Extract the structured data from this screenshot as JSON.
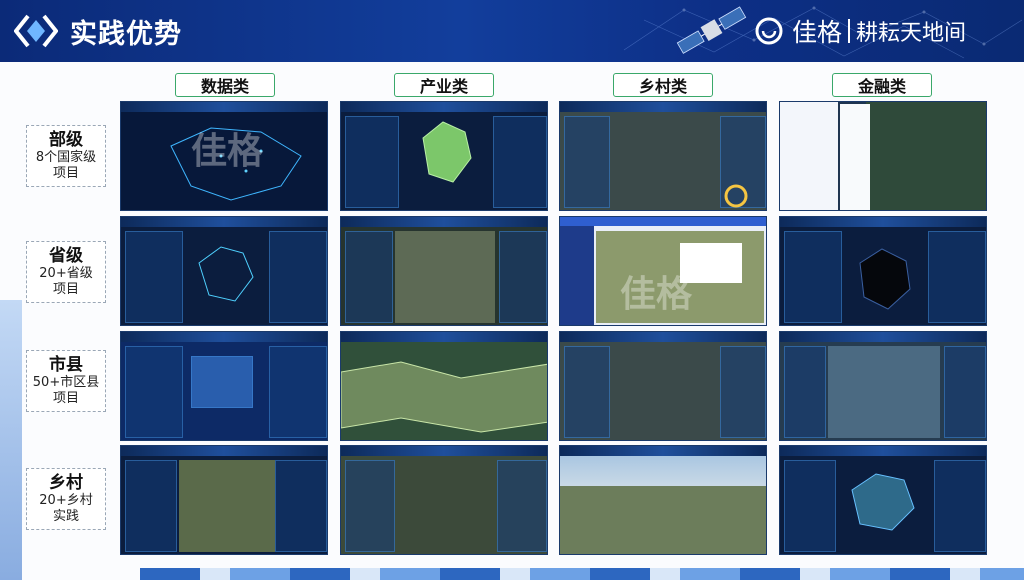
{
  "header": {
    "title": "实践优势",
    "brand": "佳格",
    "slogan": "耕耘天地间"
  },
  "columns": [
    {
      "label": "数据类"
    },
    {
      "label": "产业类"
    },
    {
      "label": "乡村类"
    },
    {
      "label": "金融类"
    }
  ],
  "rows": [
    {
      "level": "部级",
      "line1": "8个国家级",
      "line2": "项目"
    },
    {
      "level": "省级",
      "line1": "20+省级",
      "line2": "项目"
    },
    {
      "level": "市县",
      "line1": "50+市区县",
      "line2": "项目"
    },
    {
      "level": "乡村",
      "line1": "20+乡村",
      "line2": "实践"
    }
  ],
  "watermark": "佳格",
  "colors": {
    "header": "#123e9c",
    "column_border": "#3aa86a",
    "dashboard_bg": "#0b1d3e"
  }
}
